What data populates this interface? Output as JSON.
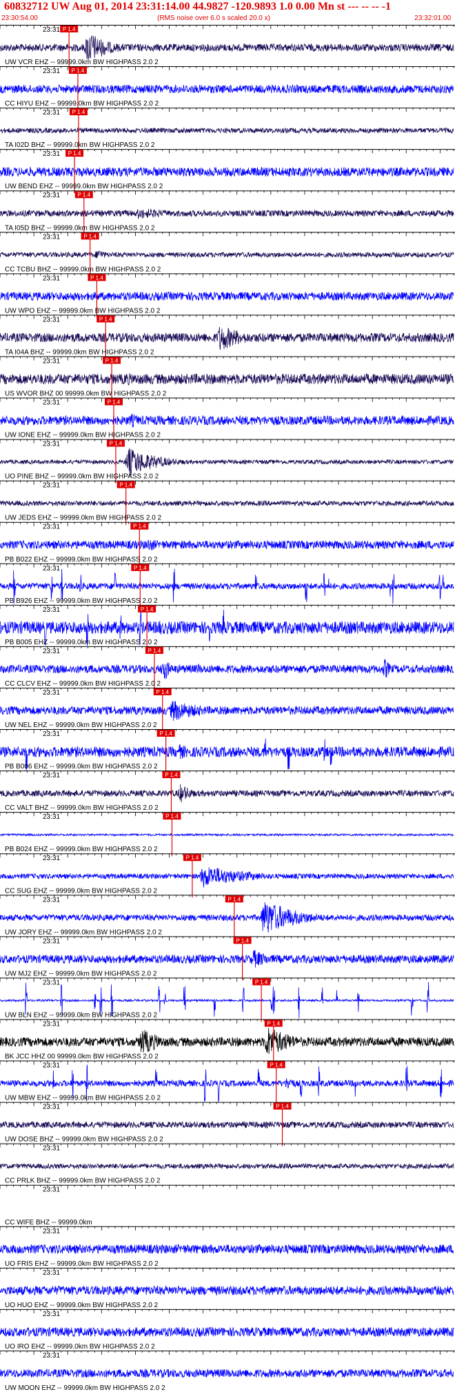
{
  "header": {
    "title": "60832712 UW Aug 01, 2014 23:31:14.00   44.9827 -120.9893  1.0 0.00 Mn st --- -- --   -1",
    "start_time": "23:30:54.00",
    "end_time": "23:32:01.00",
    "subtitle": "(RMS noise over 6.0 s scaled 20.0 x)"
  },
  "colors": {
    "header": "#e00000",
    "pick": "#e00000",
    "blue": "#0000ff",
    "dark": "#1a0a55",
    "black": "#000000",
    "axis": "#000000"
  },
  "chart_data": {
    "type": "line",
    "title": "60832712 UW Aug 01, 2014 23:31:14.00   44.9827 -120.9893  1.0 0.00 Mn st --- -- --   -1",
    "subtitle": "(RMS noise over 6.0 s scaled 20.0 x)",
    "x_range": [
      "23:30:54.00",
      "23:32:01.00"
    ],
    "time_tick_label": "23:31",
    "traces": [
      {
        "label": "UW VCR EHZ -- 99999.0km BW  HIGHPASS  2.0  2",
        "pick_label": "P 1.4",
        "color": "dark",
        "pick_x": 10.2,
        "amp_noise": 0.18,
        "events": [
          {
            "t": 12.5,
            "amp": 1.0,
            "dur": 6
          }
        ]
      },
      {
        "label": "CC HIYU EHZ -- 99999.0km BW  HIGHPASS  2.0  2",
        "pick_label": "P 1.4",
        "color": "blue",
        "pick_x": 11.5,
        "amp_noise": 0.2,
        "events": []
      },
      {
        "label": "TA I02D BHZ -- 99999.0km BW  HIGHPASS  2.0  2",
        "pick_label": "P 1.4",
        "color": "dark",
        "pick_x": 11.6,
        "amp_noise": 0.12,
        "events": []
      },
      {
        "label": "UW BEND EHZ -- 99999.0km BW  HIGHPASS  2.0  2",
        "pick_label": "P 1.4",
        "color": "blue",
        "pick_x": 11.0,
        "amp_noise": 0.22,
        "events": []
      },
      {
        "label": "TA I05D BHZ -- 99999.0km BW  HIGHPASS  2.0  2",
        "pick_label": "P 1.4",
        "color": "dark",
        "pick_x": 12.4,
        "amp_noise": 0.15,
        "events": [
          {
            "t": 20.0,
            "amp": 0.3,
            "dur": 14
          }
        ]
      },
      {
        "label": "CC TCBU BHZ -- 99999.0km BW  HIGHPASS  2.0  2",
        "pick_label": "P 1.4",
        "color": "dark",
        "pick_x": 13.3,
        "amp_noise": 0.12,
        "events": [
          {
            "t": 14.0,
            "amp": 0.4,
            "dur": 3
          }
        ]
      },
      {
        "label": "UW WPO EHZ -- 99999.0km BW  HIGHPASS  2.0  2",
        "pick_label": "P 1.4",
        "color": "blue",
        "pick_x": 14.3,
        "amp_noise": 0.2,
        "events": [
          {
            "t": 28.0,
            "amp": 0.3,
            "dur": 6
          }
        ]
      },
      {
        "label": "TA I04A BHZ -- 99999.0km BW  HIGHPASS  2.0  2",
        "pick_label": "P 1.4",
        "color": "dark",
        "pick_x": 15.6,
        "amp_noise": 0.22,
        "events": [
          {
            "t": 32.0,
            "amp": 0.75,
            "dur": 8
          }
        ]
      },
      {
        "label": "US WVOR BHZ 00 99999.0km BW  HIGHPASS  2.0  2",
        "pick_label": "P 1.4",
        "color": "dark",
        "pick_x": 16.5,
        "amp_noise": 0.25,
        "events": [
          {
            "t": 18.0,
            "amp": 0.4,
            "dur": 6
          }
        ]
      },
      {
        "label": "UW IONE EHZ -- 99999.0km BW  HIGHPASS  2.0  2",
        "pick_label": "P 1.4",
        "color": "blue",
        "pick_x": 16.8,
        "amp_noise": 0.22,
        "events": [
          {
            "t": 19.0,
            "amp": 0.45,
            "dur": 4
          }
        ]
      },
      {
        "label": "UO PINE BHZ -- 99999.0km BW  HIGHPASS  2.0  2",
        "pick_label": "P 1.4",
        "color": "dark",
        "pick_x": 17.1,
        "amp_noise": 0.1,
        "events": [
          {
            "t": 18.5,
            "amp": 0.8,
            "dur": 9
          }
        ]
      },
      {
        "label": "UW JEDS EHZ -- 99999.0km BW  HIGHPASS  2.0  2",
        "pick_label": "P 1.4",
        "color": "dark",
        "pick_x": 18.6,
        "amp_noise": 0.12,
        "events": []
      },
      {
        "label": "PB B022 EHZ -- 99999.0km BW  HIGHPASS  2.0  2",
        "pick_label": "P 1.4",
        "color": "blue",
        "pick_x": 20.6,
        "amp_noise": 0.2,
        "events": [
          {
            "t": 21.5,
            "amp": 0.45,
            "dur": 4
          }
        ]
      },
      {
        "label": "PB B926 EHZ -- 99999.0km BW  HIGHPASS  2.0  2",
        "pick_label": "P 1.4",
        "color": "blue",
        "pick_x": 20.7,
        "amp_noise": 0.15,
        "events": [],
        "spikes": 14
      },
      {
        "label": "PB B005 EHZ -- 99999.0km BW  HIGHPASS  2.0  2",
        "pick_label": "P 1.4",
        "color": "blue",
        "pick_x": 21.7,
        "amp_noise": 0.3,
        "events": [
          {
            "t": 23.0,
            "amp": 0.5,
            "dur": 4
          }
        ],
        "spikes": 6
      },
      {
        "label": "CC CLCV EHZ -- 99999.0km BW  HIGHPASS  2.0  2",
        "pick_label": "P 1.4",
        "color": "blue",
        "pick_x": 22.8,
        "amp_noise": 0.2,
        "events": [
          {
            "t": 23.8,
            "amp": 1.0,
            "dur": 2
          },
          {
            "t": 29.0,
            "amp": 0.7,
            "dur": 1
          },
          {
            "t": 56.5,
            "amp": 1.0,
            "dur": 1.5
          }
        ]
      },
      {
        "label": "UW NEL EHZ -- 99999.0km BW  HIGHPASS  2.0  2",
        "pick_label": "P 1.4",
        "color": "blue",
        "pick_x": 24.0,
        "amp_noise": 0.2,
        "events": [
          {
            "t": 25.0,
            "amp": 0.6,
            "dur": 10
          }
        ]
      },
      {
        "label": "PB B006 EHZ -- 99999.0km BW  HIGHPASS  2.0  2",
        "pick_label": "P 1.4",
        "color": "blue",
        "pick_x": 24.5,
        "amp_noise": 0.25,
        "events": [
          {
            "t": 26.0,
            "amp": 0.45,
            "dur": 6
          }
        ],
        "spikes": 5
      },
      {
        "label": "CC VALT BHZ -- 99999.0km BW  HIGHPASS  2.0  2",
        "pick_label": "P 1.4",
        "color": "dark",
        "pick_x": 25.3,
        "amp_noise": 0.15,
        "events": [
          {
            "t": 26.2,
            "amp": 0.6,
            "dur": 4
          }
        ]
      },
      {
        "label": "PB B024 EHZ -- 99999.0km BW  HIGHPASS  2.0  2",
        "pick_label": "P 1.4",
        "color": "blue",
        "pick_x": 25.4,
        "amp_noise": 0.05,
        "events": []
      },
      {
        "label": "CC SUG EHZ -- 99999.0km BW  HIGHPASS  2.0  2",
        "pick_label": "P 1.4",
        "color": "blue",
        "pick_x": 28.4,
        "amp_noise": 0.12,
        "events": [
          {
            "t": 29.5,
            "amp": 0.6,
            "dur": 14
          }
        ]
      },
      {
        "label": "UW JORY EHZ -- 99999.0km BW  HIGHPASS  2.0  2",
        "pick_label": "P 1.4",
        "color": "blue",
        "pick_x": 34.6,
        "amp_noise": 0.15,
        "events": [
          {
            "t": 38.5,
            "amp": 1.0,
            "dur": 10
          }
        ]
      },
      {
        "label": "UW MJ2 EHZ -- 99999.0km BW  HIGHPASS  2.0  2",
        "pick_label": "P 1.4",
        "color": "blue",
        "pick_x": 35.8,
        "amp_noise": 0.2,
        "events": [
          {
            "t": 37.0,
            "amp": 0.55,
            "dur": 6
          }
        ]
      },
      {
        "label": "UW BLN EHZ -- 99999.0km BW  HIGHPASS  2.0  2",
        "pick_label": "P 1.4",
        "color": "blue",
        "pick_x": 38.6,
        "amp_noise": 0.05,
        "events": [],
        "spikes": 18
      },
      {
        "label": "BK JCC HHZ 00 99999.0km BW  HIGHPASS  2.0  2",
        "pick_label": "P 1.4",
        "color": "black",
        "pick_x": 40.4,
        "amp_noise": 0.22,
        "events": [
          {
            "t": 20.5,
            "amp": 0.8,
            "dur": 6
          },
          {
            "t": 39.0,
            "amp": 0.9,
            "dur": 8
          }
        ]
      },
      {
        "label": "UW MBW EHZ -- 99999.0km BW  HIGHPASS  2.0  2",
        "pick_label": "P 1.4",
        "color": "blue",
        "pick_x": 40.8,
        "amp_noise": 0.15,
        "events": [
          {
            "t": 42.0,
            "amp": 0.5,
            "dur": 3
          }
        ],
        "spikes": 12
      },
      {
        "label": "UW DOSE BHZ -- 99999.0km BW  HIGHPASS  2.0  2",
        "pick_label": "P 1.4",
        "color": "dark",
        "pick_x": 41.7,
        "amp_noise": 0.15,
        "events": []
      },
      {
        "label": "CC PRLK BHZ -- 99999.0km BW  HIGHPASS  2.0  2",
        "pick_label": "",
        "color": "dark",
        "amp_noise": 0.12,
        "events": []
      },
      {
        "label": "CC WIFE BHZ -- 99999.0km",
        "pick_label": "",
        "color": "none",
        "amp_noise": 0.0,
        "events": []
      },
      {
        "label": "UO FRIS EHZ -- 99999.0km BW  HIGHPASS  2.0  2",
        "pick_label": "",
        "color": "blue",
        "amp_noise": 0.22,
        "events": []
      },
      {
        "label": "UO HUO EHZ -- 99999.0km BW  HIGHPASS  2.0  2",
        "pick_label": "",
        "color": "blue",
        "amp_noise": 0.22,
        "events": []
      },
      {
        "label": "UO IRO EHZ -- 99999.0km BW  HIGHPASS  2.0  2",
        "pick_label": "",
        "color": "blue",
        "amp_noise": 0.22,
        "events": []
      },
      {
        "label": "UW MOON EHZ -- 99999.0km BW  HIGHPASS  2.0  2",
        "pick_label": "",
        "color": "blue",
        "amp_noise": 0.2,
        "events": []
      }
    ]
  }
}
